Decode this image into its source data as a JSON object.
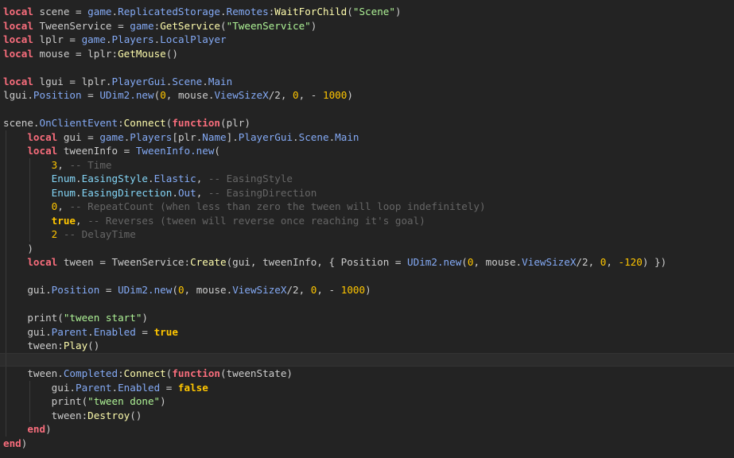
{
  "colors": {
    "background": "#232323",
    "keyword": "#f86d7c",
    "builtin": "#84aaf5",
    "method": "#fdfbac",
    "string": "#adf195",
    "number": "#ffc600",
    "comment": "#666666",
    "enum": "#84d6f7"
  },
  "current_line": 26,
  "lines": [
    [
      [
        "kw",
        "local"
      ],
      [
        "p",
        " scene = "
      ],
      [
        "g",
        "game"
      ],
      [
        "p",
        "."
      ],
      [
        "g",
        "ReplicatedStorage"
      ],
      [
        "p",
        "."
      ],
      [
        "g",
        "Remotes"
      ],
      [
        "p",
        ":"
      ],
      [
        "m",
        "WaitForChild"
      ],
      [
        "p",
        "("
      ],
      [
        "s",
        "\"Scene\""
      ],
      [
        "p",
        ")"
      ]
    ],
    [
      [
        "kw",
        "local"
      ],
      [
        "p",
        " TweenService = "
      ],
      [
        "g",
        "game"
      ],
      [
        "p",
        ":"
      ],
      [
        "m",
        "GetService"
      ],
      [
        "p",
        "("
      ],
      [
        "s",
        "\"TweenService\""
      ],
      [
        "p",
        ")"
      ]
    ],
    [
      [
        "kw",
        "local"
      ],
      [
        "p",
        " lplr = "
      ],
      [
        "g",
        "game"
      ],
      [
        "p",
        "."
      ],
      [
        "g",
        "Players"
      ],
      [
        "p",
        "."
      ],
      [
        "g",
        "LocalPlayer"
      ]
    ],
    [
      [
        "kw",
        "local"
      ],
      [
        "p",
        " mouse = lplr:"
      ],
      [
        "m",
        "GetMouse"
      ],
      [
        "p",
        "()"
      ]
    ],
    [],
    [
      [
        "kw",
        "local"
      ],
      [
        "p",
        " lgui = lplr."
      ],
      [
        "g",
        "PlayerGui"
      ],
      [
        "p",
        "."
      ],
      [
        "g",
        "Scene"
      ],
      [
        "p",
        "."
      ],
      [
        "g",
        "Main"
      ]
    ],
    [
      [
        "p",
        "lgui."
      ],
      [
        "g",
        "Position"
      ],
      [
        "p",
        " = "
      ],
      [
        "g",
        "UDim2.new"
      ],
      [
        "p",
        "("
      ],
      [
        "n",
        "0"
      ],
      [
        "p",
        ", mouse."
      ],
      [
        "g",
        "ViewSizeX"
      ],
      [
        "p",
        "/2, "
      ],
      [
        "n",
        "0"
      ],
      [
        "p",
        ", - "
      ],
      [
        "n",
        "1000"
      ],
      [
        "p",
        ")"
      ]
    ],
    [],
    [
      [
        "p",
        "scene."
      ],
      [
        "g",
        "OnClientEvent"
      ],
      [
        "p",
        ":"
      ],
      [
        "m",
        "Connect"
      ],
      [
        "p",
        "("
      ],
      [
        "kw",
        "function"
      ],
      [
        "p",
        "(plr)"
      ]
    ],
    [
      [
        "p",
        "    "
      ],
      [
        "kw",
        "local"
      ],
      [
        "p",
        " gui = "
      ],
      [
        "g",
        "game"
      ],
      [
        "p",
        "."
      ],
      [
        "g",
        "Players"
      ],
      [
        "p",
        "[plr."
      ],
      [
        "g",
        "Name"
      ],
      [
        "p",
        "]."
      ],
      [
        "g",
        "PlayerGui"
      ],
      [
        "p",
        "."
      ],
      [
        "g",
        "Scene"
      ],
      [
        "p",
        "."
      ],
      [
        "g",
        "Main"
      ]
    ],
    [
      [
        "p",
        "    "
      ],
      [
        "kw",
        "local"
      ],
      [
        "p",
        " tweenInfo = "
      ],
      [
        "g",
        "TweenInfo.new"
      ],
      [
        "p",
        "("
      ]
    ],
    [
      [
        "p",
        "        "
      ],
      [
        "n",
        "3"
      ],
      [
        "p",
        ", "
      ],
      [
        "c",
        "-- Time"
      ]
    ],
    [
      [
        "p",
        "        "
      ],
      [
        "e",
        "Enum"
      ],
      [
        "p",
        "."
      ],
      [
        "e",
        "EasingStyle"
      ],
      [
        "p",
        "."
      ],
      [
        "g",
        "Elastic"
      ],
      [
        "p",
        ", "
      ],
      [
        "c",
        "-- EasingStyle"
      ]
    ],
    [
      [
        "p",
        "        "
      ],
      [
        "e",
        "Enum"
      ],
      [
        "p",
        "."
      ],
      [
        "e",
        "EasingDirection"
      ],
      [
        "p",
        "."
      ],
      [
        "g",
        "Out"
      ],
      [
        "p",
        ", "
      ],
      [
        "c",
        "-- EasingDirection"
      ]
    ],
    [
      [
        "p",
        "        "
      ],
      [
        "n",
        "0"
      ],
      [
        "p",
        ", "
      ],
      [
        "c",
        "-- RepeatCount (when less than zero the tween will loop indefinitely)"
      ]
    ],
    [
      [
        "p",
        "        "
      ],
      [
        "b",
        "true"
      ],
      [
        "p",
        ", "
      ],
      [
        "c",
        "-- Reverses (tween will reverse once reaching it's goal)"
      ]
    ],
    [
      [
        "p",
        "        "
      ],
      [
        "n",
        "2"
      ],
      [
        "p",
        " "
      ],
      [
        "c",
        "-- DelayTime"
      ]
    ],
    [
      [
        "p",
        "    )"
      ]
    ],
    [
      [
        "p",
        "    "
      ],
      [
        "kw",
        "local"
      ],
      [
        "p",
        " tween = TweenService:"
      ],
      [
        "m",
        "Create"
      ],
      [
        "p",
        "(gui, tweenInfo, { Position = "
      ],
      [
        "g",
        "UDim2.new"
      ],
      [
        "p",
        "("
      ],
      [
        "n",
        "0"
      ],
      [
        "p",
        ", mouse."
      ],
      [
        "g",
        "ViewSizeX"
      ],
      [
        "p",
        "/2, "
      ],
      [
        "n",
        "0"
      ],
      [
        "p",
        ", "
      ],
      [
        "n",
        "-120"
      ],
      [
        "p",
        ") })"
      ]
    ],
    [],
    [
      [
        "p",
        "    gui."
      ],
      [
        "g",
        "Position"
      ],
      [
        "p",
        " = "
      ],
      [
        "g",
        "UDim2.new"
      ],
      [
        "p",
        "("
      ],
      [
        "n",
        "0"
      ],
      [
        "p",
        ", mouse."
      ],
      [
        "g",
        "ViewSizeX"
      ],
      [
        "p",
        "/2, "
      ],
      [
        "n",
        "0"
      ],
      [
        "p",
        ", - "
      ],
      [
        "n",
        "1000"
      ],
      [
        "p",
        ")"
      ]
    ],
    [],
    [
      [
        "p",
        "    print("
      ],
      [
        "s",
        "\"tween start\""
      ],
      [
        "p",
        ")"
      ]
    ],
    [
      [
        "p",
        "    gui."
      ],
      [
        "g",
        "Parent"
      ],
      [
        "p",
        "."
      ],
      [
        "g",
        "Enabled"
      ],
      [
        "p",
        " = "
      ],
      [
        "b",
        "true"
      ]
    ],
    [
      [
        "p",
        "    tween:"
      ],
      [
        "m",
        "Play"
      ],
      [
        "p",
        "()"
      ]
    ],
    [],
    [
      [
        "p",
        "    tween."
      ],
      [
        "g",
        "Completed"
      ],
      [
        "p",
        ":"
      ],
      [
        "m",
        "Connect"
      ],
      [
        "p",
        "("
      ],
      [
        "kw",
        "function"
      ],
      [
        "p",
        "(tweenState)"
      ]
    ],
    [
      [
        "p",
        "        gui."
      ],
      [
        "g",
        "Parent"
      ],
      [
        "p",
        "."
      ],
      [
        "g",
        "Enabled"
      ],
      [
        "p",
        " = "
      ],
      [
        "b",
        "false"
      ]
    ],
    [
      [
        "p",
        "        print("
      ],
      [
        "s",
        "\"tween done\""
      ],
      [
        "p",
        ")"
      ]
    ],
    [
      [
        "p",
        "        tween:"
      ],
      [
        "m",
        "Destroy"
      ],
      [
        "p",
        "()"
      ]
    ],
    [
      [
        "p",
        "    "
      ],
      [
        "kw",
        "end"
      ],
      [
        "p",
        ")"
      ]
    ],
    [
      [
        "kw",
        "end"
      ],
      [
        "p",
        ")"
      ]
    ]
  ]
}
